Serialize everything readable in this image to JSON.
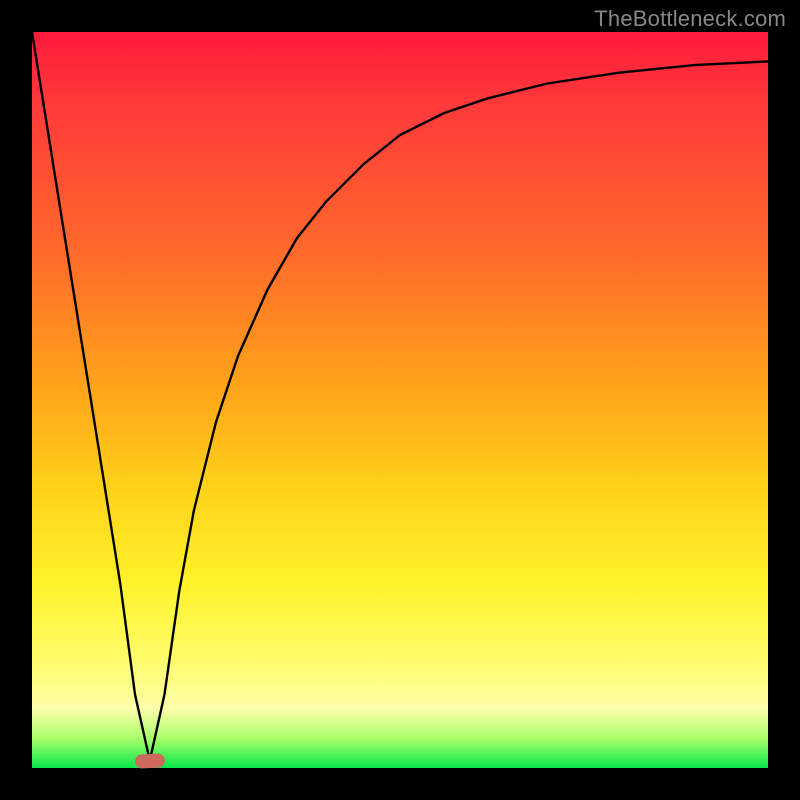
{
  "watermark": "TheBottleneck.com",
  "colors": {
    "curve_stroke": "#000000",
    "marker_fill": "#cc6a5e"
  },
  "chart_data": {
    "type": "line",
    "title": "",
    "xlabel": "",
    "ylabel": "",
    "xlim": [
      0,
      100
    ],
    "ylim": [
      0,
      100
    ],
    "grid": false,
    "legend": false,
    "annotations": [
      {
        "kind": "marker",
        "shape": "pill",
        "x": 16,
        "y": 1,
        "color": "#cc6a5e"
      }
    ],
    "series": [
      {
        "name": "bottleneck-curve",
        "color": "#000000",
        "x": [
          0,
          4,
          8,
          12,
          14,
          16,
          18,
          20,
          22,
          25,
          28,
          32,
          36,
          40,
          45,
          50,
          56,
          62,
          70,
          80,
          90,
          100
        ],
        "values": [
          100,
          75,
          50,
          25,
          10,
          1,
          10,
          24,
          35,
          47,
          56,
          65,
          72,
          77,
          82,
          86,
          89,
          91,
          93,
          94.5,
          95.5,
          96
        ]
      }
    ],
    "notes": "V-shaped dip near x≈16 reaching y≈1, then rising with diminishing slope toward ~96 at x=100. Values estimated from gradient bands (green≈0, red≈100)."
  },
  "layout": {
    "image_size": 800,
    "plot_inset": 32,
    "plot_size": 736
  }
}
